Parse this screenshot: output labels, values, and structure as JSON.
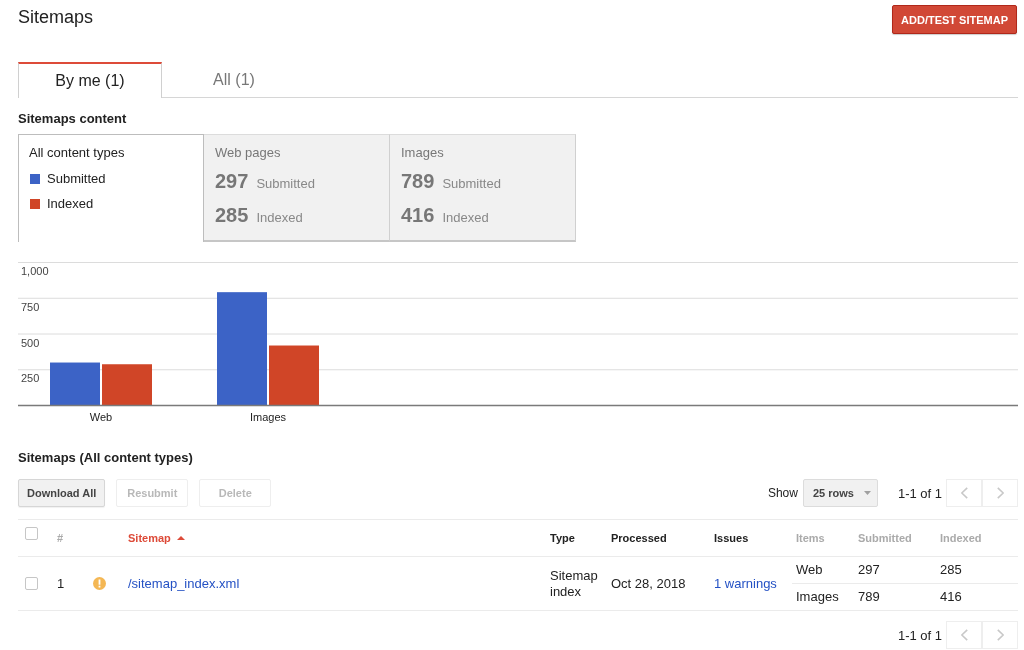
{
  "header": {
    "title": "Sitemaps",
    "button": "ADD/TEST SITEMAP"
  },
  "tabs": [
    {
      "label": "By me (1)",
      "selected": true
    },
    {
      "label": "All (1)",
      "selected": false
    }
  ],
  "content_section": {
    "title": "Sitemaps content",
    "content_types": [
      {
        "kind": "legend",
        "label": "All content types",
        "selected": true
      },
      {
        "kind": "stats",
        "label": "Web pages",
        "selected": false,
        "stats": [
          {
            "value": "297",
            "label": "Submitted"
          },
          {
            "value": "285",
            "label": "Indexed"
          }
        ]
      },
      {
        "kind": "stats",
        "label": "Images",
        "selected": false,
        "stats": [
          {
            "value": "789",
            "label": "Submitted"
          },
          {
            "value": "416",
            "label": "Indexed"
          }
        ]
      }
    ],
    "chart_data": {
      "type": "bar",
      "categories": [
        "Web",
        "Images"
      ],
      "series": [
        {
          "name": "Submitted",
          "color": "#3c63c6",
          "values": [
            297,
            789
          ]
        },
        {
          "name": "Indexed",
          "color": "#d04527",
          "values": [
            285,
            416
          ]
        }
      ],
      "ylim": [
        0,
        1000
      ],
      "yticks": [
        {
          "value": 250,
          "label": "250"
        },
        {
          "value": 500,
          "label": "500"
        },
        {
          "value": 750,
          "label": "750"
        },
        {
          "value": 1000,
          "label": "1,000"
        }
      ],
      "grid": true
    }
  },
  "sitemaps_section": {
    "title": "Sitemaps (All content types)",
    "toolbar": {
      "buttons": [
        {
          "label": "Download All",
          "disabled": false
        },
        {
          "label": "Resubmit",
          "disabled": true
        },
        {
          "label": "Delete",
          "disabled": true
        }
      ],
      "show_label": "Show",
      "rows_select": "25 rows",
      "range": "1-1 of 1",
      "prev": {
        "disabled": true
      },
      "next": {
        "disabled": true
      }
    },
    "table": {
      "all_checked": false,
      "columns": [
        {
          "label": "#",
          "sortable": false,
          "sorted": false
        },
        {
          "label": "Sitemap",
          "sortable": true,
          "sorted": true
        },
        {
          "label": "Type",
          "sortable": true,
          "sorted": false
        },
        {
          "label": "Processed",
          "sortable": true,
          "sorted": false
        },
        {
          "label": "Issues",
          "sortable": true,
          "sorted": false
        },
        {
          "label": "Items",
          "sortable": false,
          "sorted": false
        },
        {
          "label": "Submitted",
          "sortable": false,
          "sorted": false
        },
        {
          "label": "Indexed",
          "sortable": false,
          "sorted": false
        }
      ],
      "rows": [
        {
          "checked": false,
          "number": "1",
          "warning": true,
          "sitemap": "/sitemap_index.xml",
          "type": "Sitemap index",
          "processed": "Oct 28, 2018",
          "issues": "1 warnings",
          "items": [
            {
              "item": "Web",
              "submitted": "297",
              "indexed": "285"
            },
            {
              "item": "Images",
              "submitted": "789",
              "indexed": "416"
            }
          ]
        }
      ]
    },
    "footer": {
      "range": "1-1 of 1",
      "prev": {
        "disabled": true
      },
      "next": {
        "disabled": true
      }
    }
  }
}
